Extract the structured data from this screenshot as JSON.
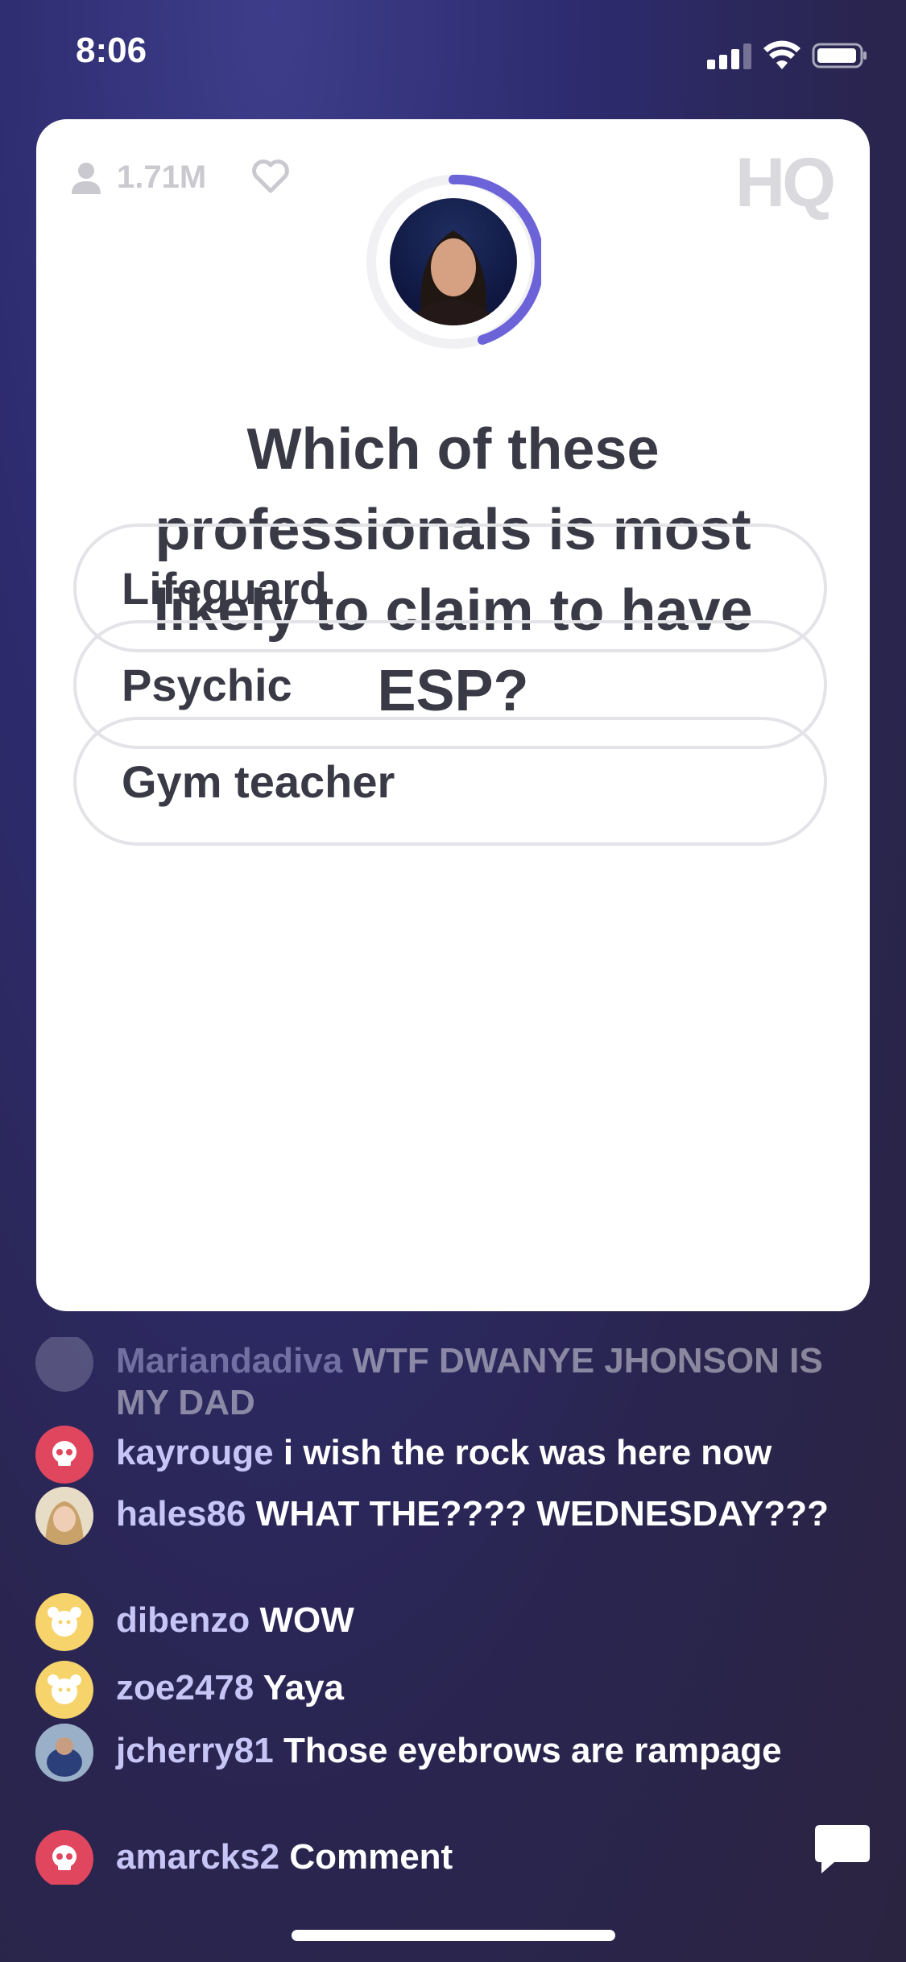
{
  "status_bar": {
    "time": "8:06"
  },
  "header": {
    "viewer_count": "1.71M",
    "logo": "HQ"
  },
  "question": {
    "text": "Which of these professionals is most likely to claim to have ESP?"
  },
  "answers": [
    {
      "label": "Lifeguard"
    },
    {
      "label": "Psychic"
    },
    {
      "label": "Gym teacher"
    }
  ],
  "chat": [
    {
      "user": "Mariandadiva",
      "text": "WTF DWANYE JHONSON IS MY DAD",
      "avatar": "photo"
    },
    {
      "user": "kayrouge",
      "text": "i wish the rock was here now",
      "avatar": "skull-icon",
      "avatar_color": "#e0475e"
    },
    {
      "user": "hales86",
      "text": "WHAT THE???? WEDNESDAY???",
      "avatar": "photo"
    },
    {
      "user": "dibenzo",
      "text": "WOW",
      "avatar": "bear-icon",
      "avatar_color": "#f6d36b"
    },
    {
      "user": "zoe2478",
      "text": "Yaya",
      "avatar": "bear-icon",
      "avatar_color": "#f6d36b"
    },
    {
      "user": "jcherry81",
      "text": "Those eyebrows are rampage",
      "avatar": "photo"
    },
    {
      "user": "amarcks2",
      "text": "Comment",
      "avatar": "skull-icon",
      "avatar_color": "#e0475e"
    }
  ],
  "colors": {
    "accent": "#6c63d9",
    "username": "#c7c5f5"
  }
}
